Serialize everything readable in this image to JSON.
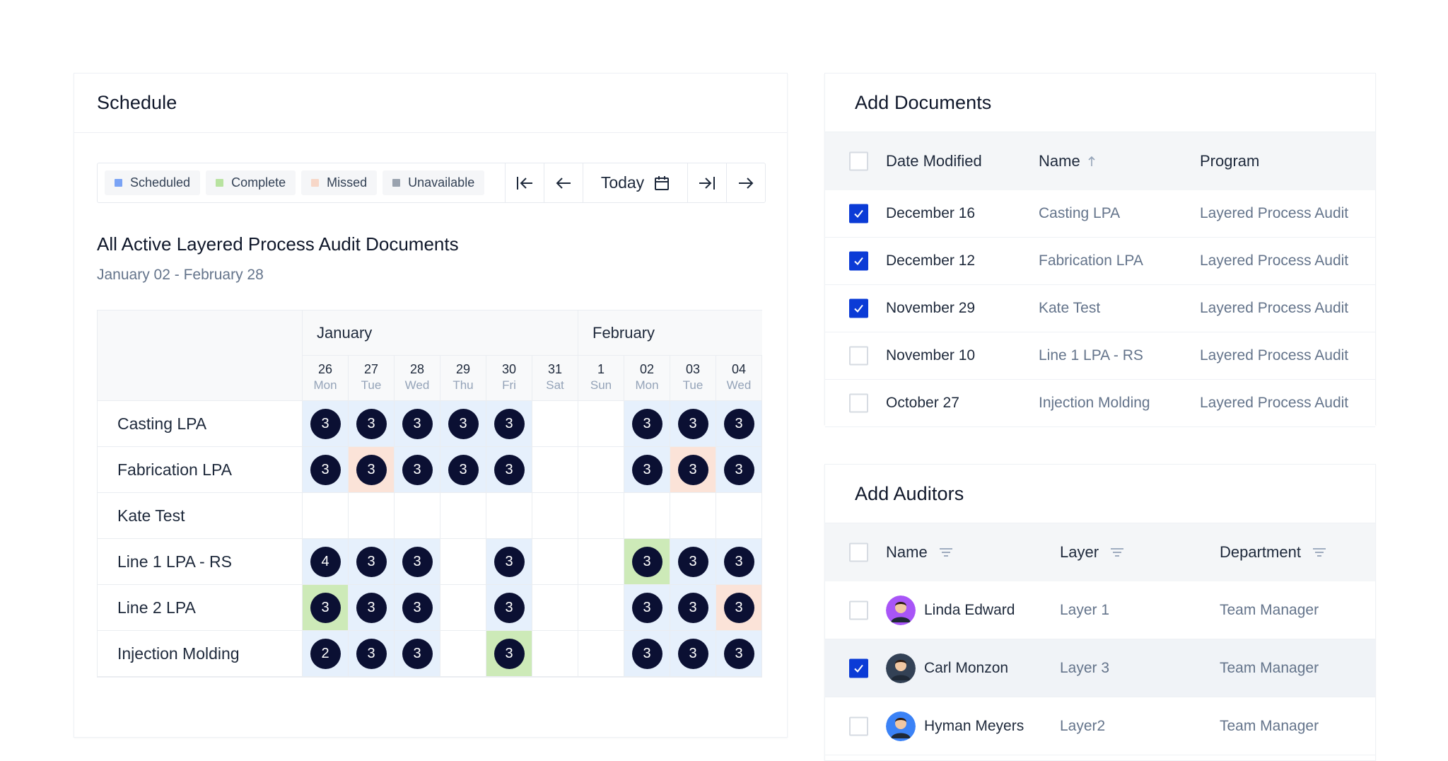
{
  "schedule": {
    "title": "Schedule",
    "legend": [
      {
        "label": "Scheduled",
        "color": "#7aa3f5"
      },
      {
        "label": "Complete",
        "color": "#b8e3a0"
      },
      {
        "label": "Missed",
        "color": "#f7d7c8"
      },
      {
        "label": "Unavailable",
        "color": "#9aa3af"
      }
    ],
    "today_label": "Today",
    "section_title": "All Active Layered Process Audit Documents",
    "date_range": "January 02 - February 28",
    "months": [
      "January",
      "February"
    ],
    "days": [
      {
        "num": "26",
        "dow": "Mon"
      },
      {
        "num": "27",
        "dow": "Tue"
      },
      {
        "num": "28",
        "dow": "Wed"
      },
      {
        "num": "29",
        "dow": "Thu"
      },
      {
        "num": "30",
        "dow": "Fri"
      },
      {
        "num": "31",
        "dow": "Sat"
      },
      {
        "num": "1",
        "dow": "Sun"
      },
      {
        "num": "02",
        "dow": "Mon"
      },
      {
        "num": "03",
        "dow": "Tue"
      },
      {
        "num": "04",
        "dow": "Wed"
      }
    ],
    "rows": [
      {
        "label": "Casting LPA",
        "cells": [
          [
            "s",
            "3"
          ],
          [
            "s",
            "3"
          ],
          [
            "s",
            "3"
          ],
          [
            "s",
            "3"
          ],
          [
            "s",
            "3"
          ],
          [
            "u",
            ""
          ],
          [
            "u",
            ""
          ],
          [
            "s",
            "3"
          ],
          [
            "s",
            "3"
          ],
          [
            "s",
            "3"
          ]
        ]
      },
      {
        "label": "Fabrication LPA",
        "cells": [
          [
            "s",
            "3"
          ],
          [
            "m",
            "3"
          ],
          [
            "s",
            "3"
          ],
          [
            "s",
            "3"
          ],
          [
            "s",
            "3"
          ],
          [
            "u",
            ""
          ],
          [
            "u",
            ""
          ],
          [
            "s",
            "3"
          ],
          [
            "m",
            "3"
          ],
          [
            "s",
            "3"
          ]
        ]
      },
      {
        "label": "Kate Test",
        "cells": [
          [
            "u",
            ""
          ],
          [
            "u",
            ""
          ],
          [
            "u",
            ""
          ],
          [
            "u",
            ""
          ],
          [
            "u",
            ""
          ],
          [
            "u",
            ""
          ],
          [
            "u",
            ""
          ],
          [
            "u",
            ""
          ],
          [
            "u",
            ""
          ],
          [
            "u",
            ""
          ]
        ]
      },
      {
        "label": "Line 1 LPA - RS",
        "cells": [
          [
            "s",
            "4"
          ],
          [
            "s",
            "3"
          ],
          [
            "s",
            "3"
          ],
          [
            "u",
            ""
          ],
          [
            "s",
            "3"
          ],
          [
            "u",
            ""
          ],
          [
            "u",
            ""
          ],
          [
            "c",
            "3"
          ],
          [
            "s",
            "3"
          ],
          [
            "s",
            "3"
          ]
        ]
      },
      {
        "label": "Line 2 LPA",
        "cells": [
          [
            "c",
            "3"
          ],
          [
            "s",
            "3"
          ],
          [
            "s",
            "3"
          ],
          [
            "u",
            ""
          ],
          [
            "s",
            "3"
          ],
          [
            "u",
            ""
          ],
          [
            "u",
            ""
          ],
          [
            "s",
            "3"
          ],
          [
            "s",
            "3"
          ],
          [
            "m",
            "3"
          ]
        ]
      },
      {
        "label": "Injection Molding",
        "cells": [
          [
            "s",
            "2"
          ],
          [
            "s",
            "3"
          ],
          [
            "s",
            "3"
          ],
          [
            "u",
            ""
          ],
          [
            "c",
            "3"
          ],
          [
            "u",
            ""
          ],
          [
            "u",
            ""
          ],
          [
            "s",
            "3"
          ],
          [
            "s",
            "3"
          ],
          [
            "s",
            "3"
          ]
        ]
      }
    ]
  },
  "documents": {
    "title": "Add Documents",
    "columns": {
      "date": "Date Modified",
      "name": "Name",
      "program": "Program"
    },
    "rows": [
      {
        "checked": true,
        "date": "December 16",
        "name": "Casting LPA",
        "program": "Layered Process Audit"
      },
      {
        "checked": true,
        "date": "December 12",
        "name": "Fabrication LPA",
        "program": "Layered Process Audit"
      },
      {
        "checked": true,
        "date": "November 29",
        "name": "Kate Test",
        "program": "Layered Process Audit"
      },
      {
        "checked": false,
        "date": "November 10",
        "name": "Line 1 LPA - RS",
        "program": "Layered Process Audit"
      },
      {
        "checked": false,
        "date": "October 27",
        "name": "Injection Molding",
        "program": "Layered Process Audit"
      }
    ]
  },
  "auditors": {
    "title": "Add Auditors",
    "columns": {
      "name": "Name",
      "layer": "Layer",
      "department": "Department"
    },
    "rows": [
      {
        "checked": false,
        "name": "Linda Edward",
        "layer": "Layer 1",
        "department": "Team Manager",
        "avatar_color": "#a855f7"
      },
      {
        "checked": true,
        "name": "Carl Monzon",
        "layer": "Layer 3",
        "department": "Team Manager",
        "avatar_color": "#334155"
      },
      {
        "checked": false,
        "name": "Hyman Meyers",
        "layer": "Layer2",
        "department": "Team Manager",
        "avatar_color": "#3b82f6"
      }
    ]
  }
}
